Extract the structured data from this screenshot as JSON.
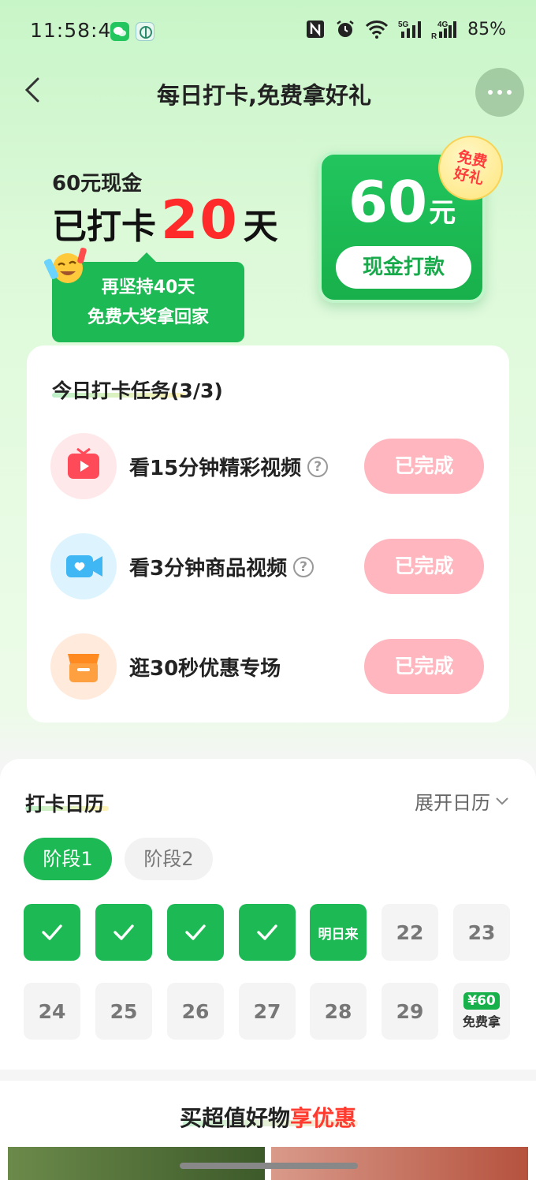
{
  "status_bar": {
    "time": "11:58:44",
    "battery": "85%",
    "icons": [
      "wechat-icon",
      "app-icon",
      "nfc-icon",
      "alarm-icon",
      "wifi-icon",
      "signal-5g-icon",
      "signal-4g-icon"
    ]
  },
  "nav": {
    "title": "每日打卡,免费拿好礼",
    "back_icon": "chevron-left-icon",
    "more_icon": "more-dots-icon"
  },
  "hero": {
    "subtitle": "60元现金",
    "checked_prefix": "已打卡",
    "checked_days": "20",
    "checked_suffix": "天",
    "bubble_line1": "再坚持40天",
    "bubble_line2": "免费大奖拿回家"
  },
  "cash_card": {
    "amount": "60",
    "unit": "元",
    "button_label": "现金打款",
    "badge_line1": "免费",
    "badge_line2": "好礼"
  },
  "tasks": {
    "title": "今日打卡任务(3/3)",
    "items": [
      {
        "label": "看15分钟精彩视频",
        "has_help": true,
        "button": "已完成",
        "icon": "tv-icon"
      },
      {
        "label": "看3分钟商品视频",
        "has_help": true,
        "button": "已完成",
        "icon": "video-camera-icon"
      },
      {
        "label": "逛30秒优惠专场",
        "has_help": false,
        "button": "已完成",
        "icon": "store-icon"
      }
    ],
    "help_symbol": "?"
  },
  "calendar": {
    "title": "打卡日历",
    "expand_label": "展开日历",
    "stages": [
      "阶段1",
      "阶段2"
    ],
    "row1": [
      "",
      "",
      "",
      "",
      "明日来",
      "22",
      "23"
    ],
    "row2": [
      "24",
      "25",
      "26",
      "27",
      "28",
      "29"
    ],
    "prize_amount": "¥60",
    "prize_label": "免费拿"
  },
  "promo": {
    "title_part1": "买超值好物",
    "title_part2": "享优惠"
  },
  "colors": {
    "accent_green": "#1db954",
    "highlight_red": "#ff2a2a",
    "done_pink": "#ffb6be"
  }
}
